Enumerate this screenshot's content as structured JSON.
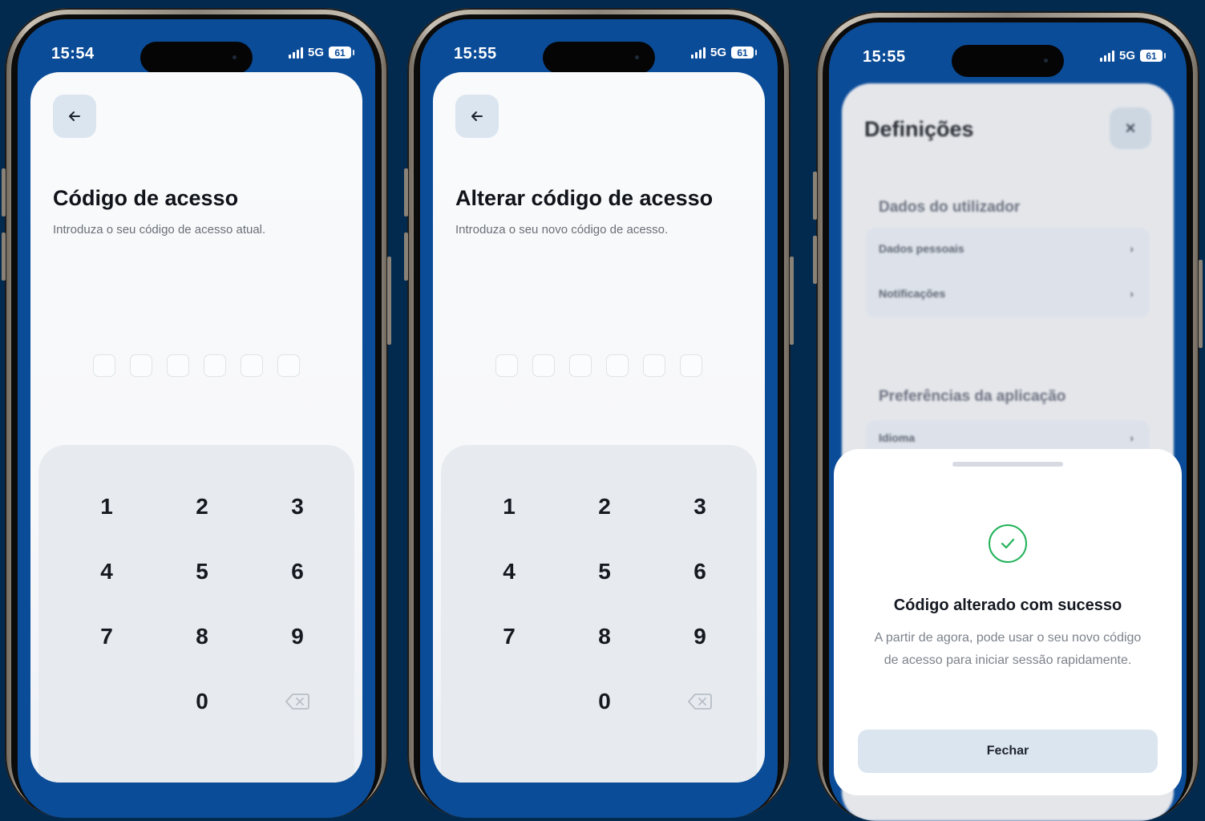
{
  "screens": [
    {
      "time": "15:54",
      "network": "5G",
      "battery": "61",
      "title": "Código de acesso",
      "subtitle": "Introduza o seu código de acesso atual.",
      "keys": [
        "1",
        "2",
        "3",
        "4",
        "5",
        "6",
        "7",
        "8",
        "9",
        "0"
      ]
    },
    {
      "time": "15:55",
      "network": "5G",
      "battery": "61",
      "title": "Alterar código de acesso",
      "subtitle": "Introduza o seu novo código de acesso.",
      "keys": [
        "1",
        "2",
        "3",
        "4",
        "5",
        "6",
        "7",
        "8",
        "9",
        "0"
      ]
    },
    {
      "time": "15:55",
      "network": "5G",
      "battery": "61",
      "settings": {
        "title": "Definições",
        "close_icon": "×",
        "section_user": "Dados do utilizador",
        "item_personal": "Dados pessoais",
        "item_notifications": "Notificações",
        "section_app": "Preferências da aplicação",
        "item_language": "Idioma"
      },
      "sheet": {
        "title": "Código alterado com sucesso",
        "body": "A partir de agora, pode usar o seu novo código de acesso para iniciar sessão rapidamente.",
        "close_label": "Fechar"
      }
    }
  ],
  "colors": {
    "background": "#022a4f",
    "screen_blue": "#0b4c98",
    "success_green": "#22b25a",
    "button_light": "#dbe5f0"
  },
  "icons": {
    "back": "arrow-left-icon",
    "delete": "backspace-icon",
    "chevron": "chevron-right-icon",
    "success": "check-circle-icon"
  }
}
